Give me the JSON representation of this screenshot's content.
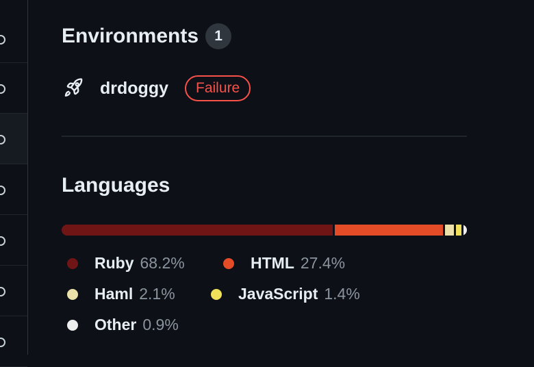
{
  "environments": {
    "title": "Environments",
    "count": "1",
    "items": [
      {
        "name": "drdoggy",
        "status": "Failure",
        "status_color": "#f85149",
        "icon": "rocket-icon"
      }
    ]
  },
  "languages": {
    "title": "Languages",
    "items": [
      {
        "name": "Ruby",
        "percent": "68.2%",
        "value": 68.2,
        "color": "#701516"
      },
      {
        "name": "HTML",
        "percent": "27.4%",
        "value": 27.4,
        "color": "#e34c26"
      },
      {
        "name": "Haml",
        "percent": "2.1%",
        "value": 2.1,
        "color": "#ece2a9"
      },
      {
        "name": "JavaScript",
        "percent": "1.4%",
        "value": 1.4,
        "color": "#f1e05a"
      },
      {
        "name": "Other",
        "percent": "0.9%",
        "value": 0.9,
        "color": "#ededed"
      }
    ]
  }
}
